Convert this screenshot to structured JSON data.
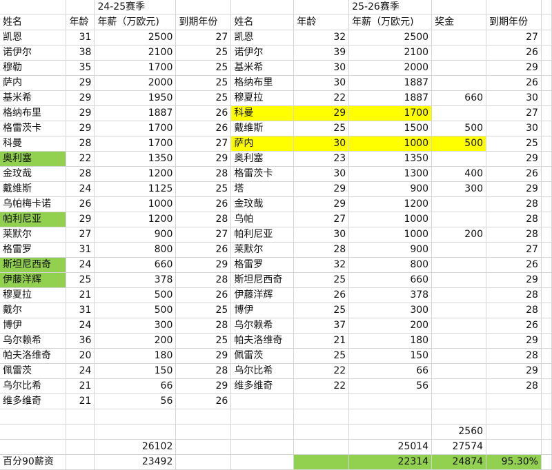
{
  "sheet": {
    "season_24_25": "24-25赛季",
    "season_25_26": "25-26赛季",
    "headers_left": [
      "姓名",
      "年龄",
      "年薪（万欧元)",
      "到期年份"
    ],
    "headers_right": [
      "姓名",
      "年龄",
      "年薪（万欧元)",
      "奖金",
      "到期年份"
    ],
    "rows_left": [
      [
        "凯恩",
        "31",
        "2500",
        "27"
      ],
      [
        "诺伊尔",
        "38",
        "2100",
        "25"
      ],
      [
        "穆勒",
        "35",
        "1700",
        "25"
      ],
      [
        "萨内",
        "29",
        "2000",
        "25"
      ],
      [
        "基米希",
        "29",
        "1950",
        "25"
      ],
      [
        "格纳布里",
        "29",
        "1887",
        "26"
      ],
      [
        "格雷茨卡",
        "29",
        "1700",
        "26"
      ],
      [
        "科曼",
        "28",
        "1700",
        "27"
      ],
      [
        "奥利塞",
        "22",
        "1350",
        "29"
      ],
      [
        "金玟哉",
        "28",
        "1200",
        "28"
      ],
      [
        "戴维斯",
        "24",
        "1125",
        "25"
      ],
      [
        "乌帕梅卡诺",
        "26",
        "1000",
        "26"
      ],
      [
        "帕利尼亚",
        "29",
        "1200",
        "28"
      ],
      [
        "莱默尔",
        "27",
        "900",
        "27"
      ],
      [
        "格雷罗",
        "31",
        "800",
        "26"
      ],
      [
        "斯坦尼西奇",
        "24",
        "660",
        "29"
      ],
      [
        "伊藤洋辉",
        "25",
        "378",
        "28"
      ],
      [
        "穆夏拉",
        "21",
        "500",
        "26"
      ],
      [
        "戴尔",
        "31",
        "500",
        "25"
      ],
      [
        "博伊",
        "24",
        "300",
        "28"
      ],
      [
        "乌尔赖希",
        "36",
        "200",
        "25"
      ],
      [
        "帕夫洛维奇",
        "20",
        "180",
        "29"
      ],
      [
        "佩雷茨",
        "24",
        "150",
        "28"
      ],
      [
        "乌尔比希",
        "21",
        "66",
        "29"
      ],
      [
        "维多维奇",
        "21",
        "56",
        "26"
      ]
    ],
    "rows_right": [
      [
        "凯恩",
        "32",
        "2500",
        "",
        "27"
      ],
      [
        "诺伊尔",
        "39",
        "2100",
        "",
        "26"
      ],
      [
        "基米希",
        "30",
        "2000",
        "",
        "29"
      ],
      [
        "格纳布里",
        "30",
        "1887",
        "",
        "26"
      ],
      [
        "穆夏拉",
        "22",
        "1887",
        "660",
        "30"
      ],
      [
        "科曼",
        "29",
        "1700",
        "",
        "27"
      ],
      [
        "戴维斯",
        "25",
        "1500",
        "500",
        "30"
      ],
      [
        "萨内",
        "30",
        "1000",
        "500",
        "25"
      ],
      [
        "奥利塞",
        "23",
        "1350",
        "",
        "29"
      ],
      [
        "格雷茨卡",
        "30",
        "1300",
        "400",
        "26"
      ],
      [
        "塔",
        "29",
        "900",
        "300",
        "29"
      ],
      [
        "金玟哉",
        "29",
        "1200",
        "",
        "28"
      ],
      [
        "乌帕",
        "27",
        "1000",
        "",
        "28"
      ],
      [
        "帕利尼亚",
        "30",
        "1000",
        "200",
        "28"
      ],
      [
        "莱默尔",
        "28",
        "900",
        "",
        "27"
      ],
      [
        "格雷罗",
        "32",
        "800",
        "",
        "26"
      ],
      [
        "斯坦尼西奇",
        "25",
        "660",
        "",
        "29"
      ],
      [
        "伊藤洋辉",
        "26",
        "378",
        "",
        "28"
      ],
      [
        "博伊",
        "25",
        "300",
        "",
        "28"
      ],
      [
        "乌尔赖希",
        "37",
        "200",
        "",
        "26"
      ],
      [
        "帕夫洛维奇",
        "21",
        "180",
        "",
        "29"
      ],
      [
        "佩雷茨",
        "25",
        "150",
        "",
        "28"
      ],
      [
        "乌尔比希",
        "22",
        "66",
        "",
        "29"
      ],
      [
        "维多维奇",
        "22",
        "56",
        "",
        "28"
      ]
    ],
    "highlight_yellow_right_rows": [
      5,
      7
    ],
    "highlight_green_left_rows": [
      8,
      12,
      15,
      16
    ],
    "bonus_total": "2560",
    "total_left": "26102",
    "total_right": "25014",
    "total_right_with_bonus": "27574",
    "pct90_label": "百分90薪资",
    "pct90_left": "23492",
    "pct90_right": "22314",
    "pct90_right_with_bonus": "24874",
    "pct90_ratio": "95.30%",
    "colors": {
      "yellow": "#ffff00",
      "green": "#92d050",
      "grid": "#d4d4d4"
    }
  }
}
